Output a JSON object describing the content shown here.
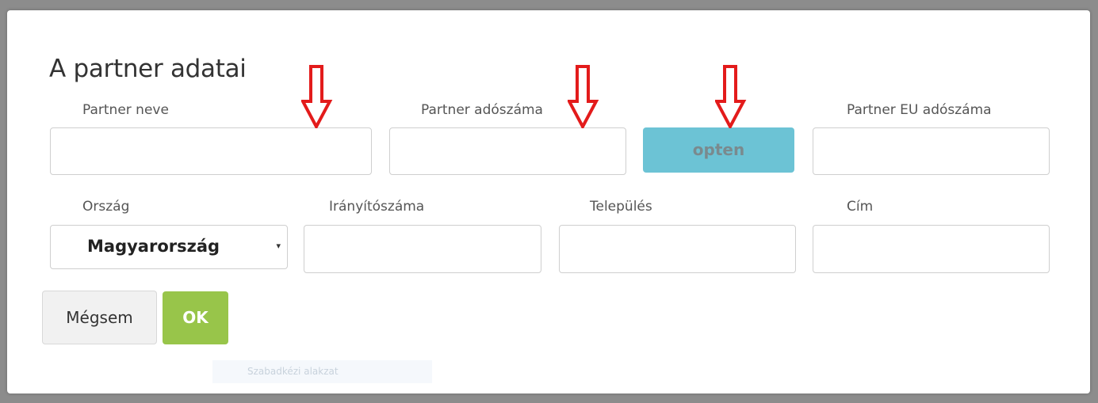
{
  "dialog": {
    "title": "A partner adatai"
  },
  "fields": {
    "partner_name": {
      "label": "Partner neve",
      "value": ""
    },
    "partner_tax": {
      "label": "Partner adószáma",
      "value": ""
    },
    "partner_eu_tax": {
      "label": "Partner EU adószáma",
      "value": ""
    },
    "country": {
      "label": "Ország",
      "value": "Magyarország"
    },
    "zip": {
      "label": "Irányítószáma",
      "value": ""
    },
    "city": {
      "label": "Település",
      "value": ""
    },
    "address": {
      "label": "Cím",
      "value": ""
    }
  },
  "buttons": {
    "opten": "opten",
    "cancel": "Mégsem",
    "ok": "OK"
  },
  "background_label": "Szabadkézi alakzat",
  "colors": {
    "opten_button": "#6cc3d5",
    "ok_button": "#98c54a",
    "annotation_arrow": "#e31b1b"
  },
  "icons": {
    "select_caret": "▾",
    "annotation": "down-arrow"
  }
}
